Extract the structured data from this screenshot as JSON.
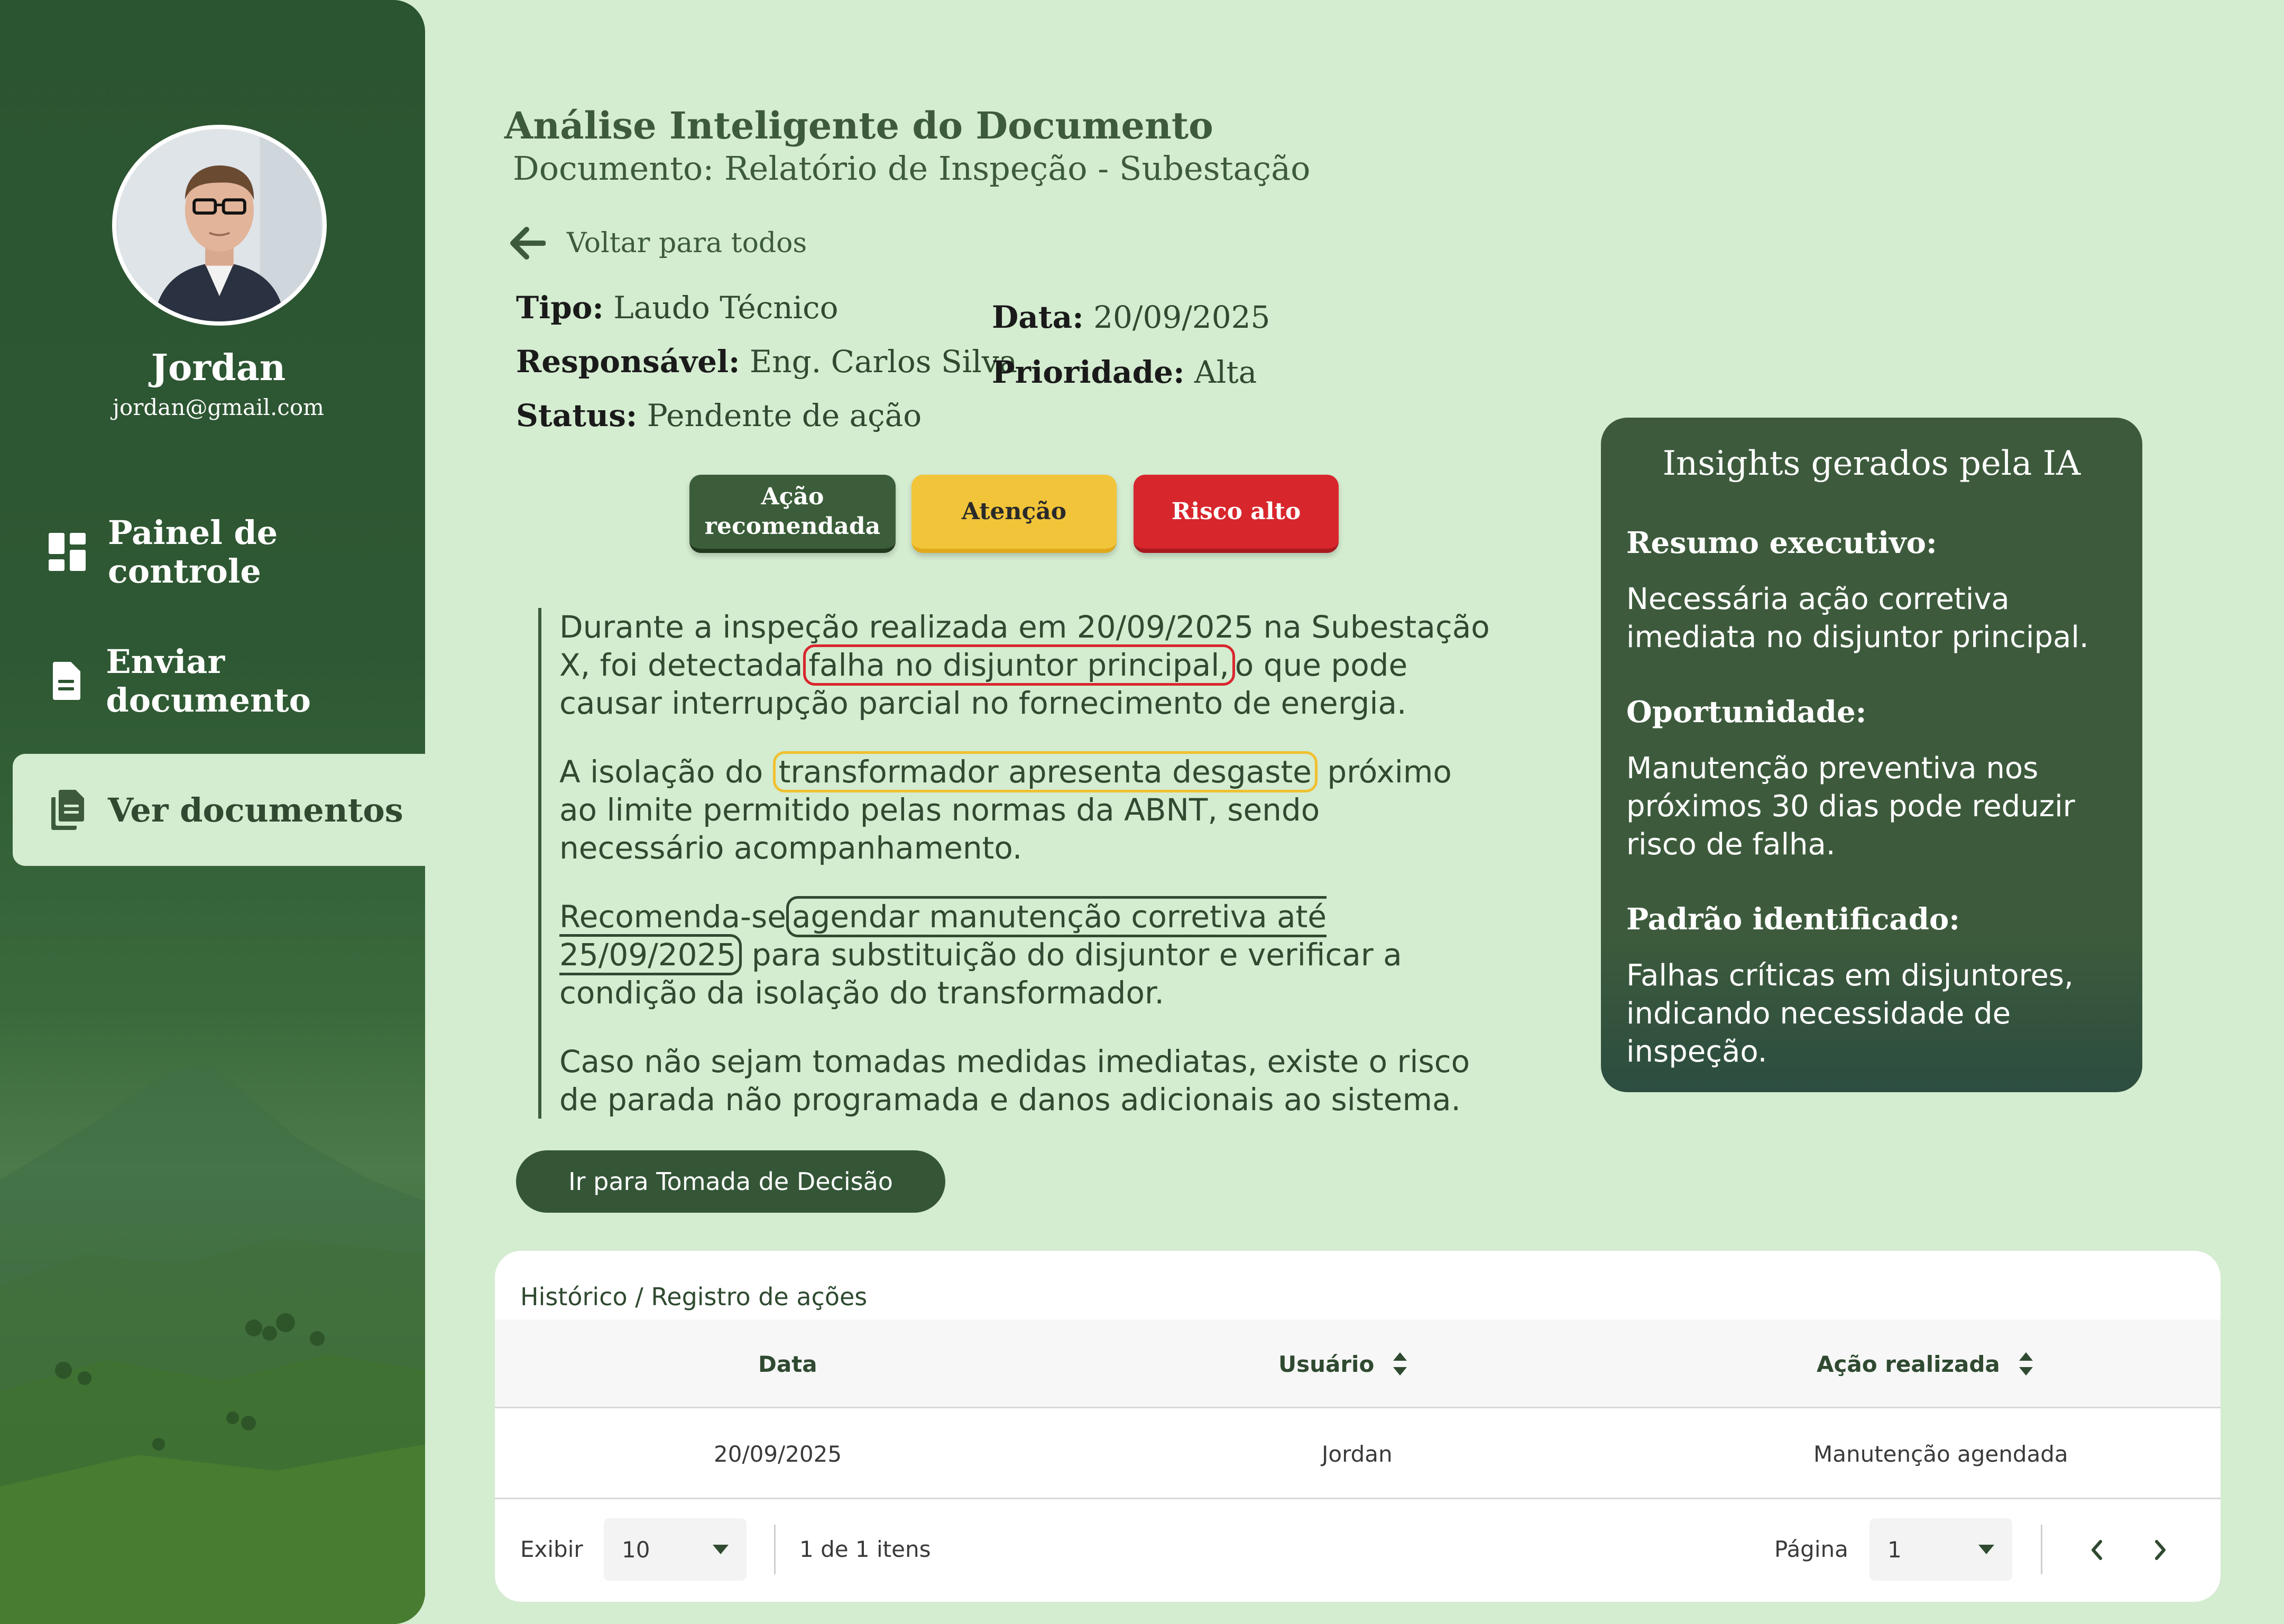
{
  "user": {
    "name": "Jordan",
    "email": "jordan@gmail.com"
  },
  "nav": {
    "items": [
      {
        "label": "Painel de controle",
        "icon": "dashboard-icon",
        "active": false
      },
      {
        "label": "Enviar documento",
        "icon": "document-icon",
        "active": false
      },
      {
        "label": "Ver documentos",
        "icon": "documents-icon",
        "active": true
      }
    ]
  },
  "header": {
    "title": "Análise Inteligente do Documento",
    "subtitle": "Documento: Relatório de Inspeção - Subestação",
    "back_label": "Voltar para todos"
  },
  "meta": {
    "tipo_label": "Tipo:",
    "tipo_value": "Laudo Técnico",
    "responsavel_label": "Responsável:",
    "responsavel_value": "Eng. Carlos Silva",
    "status_label": "Status:",
    "status_value": "Pendente de ação",
    "data_label": "Data:",
    "data_value": "20/09/2025",
    "prioridade_label": "Prioridade:",
    "prioridade_value": "Alta"
  },
  "tags": {
    "recommended_line1": "Ação",
    "recommended_line2": "recomendada",
    "attention": "Atenção",
    "high_risk": "Risco alto"
  },
  "document": {
    "p1_before": "Durante a inspeção realizada em 20/09/2025 na Subestação X, foi detectada",
    "p1_highlight": "falha no disjuntor principal,",
    "p1_after": "o que pode causar interrupção parcial no fornecimento de energia.",
    "p2_before": "A isolação do",
    "p2_highlight": "transformador apresenta desgaste",
    "p2_after": "próximo ao limite permitido pelas normas da ABNT, sendo necessário acompanhamento.",
    "p3_before": "Recomenda-se",
    "p3_highlight": "agendar manutenção corretiva até 25/09/2025",
    "p3_after": "para substituição do disjuntor e verificar a condição da isolação do transformador.",
    "p4": "Caso não sejam tomadas medidas imediatas, existe o risco de parada não programada e danos adicionais ao sistema."
  },
  "decision_button": "Ir para Tomada de Decisão",
  "insights": {
    "title": "Insights gerados pela IA",
    "summary_label": "Resumo executivo:",
    "summary_text": "Necessária ação corretiva imediata no disjuntor principal.",
    "opportunity_label": "Oportunidade:",
    "opportunity_text": "Manutenção preventiva nos próximos 30 dias pode reduzir risco de falha.",
    "pattern_label": "Padrão identificado:",
    "pattern_text": "Falhas críticas em disjuntores, indicando necessidade de inspeção."
  },
  "history": {
    "title": "Histórico / Registro de ações",
    "columns": [
      "Data",
      "Usuário",
      "Ação realizada"
    ],
    "rows": [
      [
        "20/09/2025",
        "Jordan",
        "Manutenção agendada"
      ]
    ],
    "footer": {
      "show_label": "Exibir",
      "page_size": "10",
      "count_text": "1 de 1 itens",
      "page_label": "Página",
      "page_value": "1"
    }
  },
  "colors": {
    "sidebar": "#2b5430",
    "background": "#d4ecd0",
    "primary": "#3d5b3c",
    "attention": "#f2c43a",
    "danger": "#d8262d"
  }
}
